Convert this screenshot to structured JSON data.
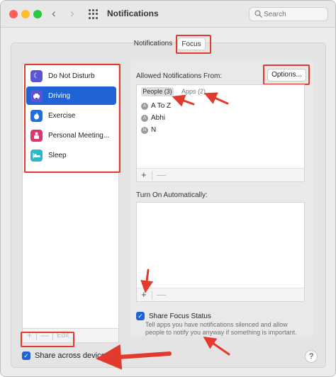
{
  "window": {
    "title": "Notifications"
  },
  "search": {
    "placeholder": "Search"
  },
  "tabs": [
    {
      "label": "Notifications"
    },
    {
      "label": "Focus"
    }
  ],
  "focus_modes": [
    {
      "label": "Do Not Disturb",
      "icon": "moon-icon",
      "color": "#5b55d6",
      "selected": false
    },
    {
      "label": "Driving",
      "icon": "car-icon",
      "color": "#5b55d6",
      "selected": true
    },
    {
      "label": "Exercise",
      "icon": "flame-icon",
      "color": "#1f6fe0",
      "selected": false
    },
    {
      "label": "Personal Meeting...",
      "icon": "person-icon",
      "color": "#e0356b",
      "selected": false
    },
    {
      "label": "Sleep",
      "icon": "bed-icon",
      "color": "#2fb6c9",
      "selected": false
    }
  ],
  "list_controls": {
    "add": "+",
    "remove": "—",
    "edit": "Edit"
  },
  "share_across_devices": {
    "label": "Share across devices",
    "checked": true
  },
  "allowed": {
    "label": "Allowed Notifications From:",
    "options_button": "Options...",
    "segments": {
      "people": "People (3)",
      "apps": "Apps (2)"
    },
    "people": [
      {
        "initial": "A",
        "name": "A To Z"
      },
      {
        "initial": "A",
        "name": "Abhi"
      },
      {
        "initial": "N",
        "name": "N"
      }
    ]
  },
  "turn_on": {
    "label": "Turn On Automatically:"
  },
  "share_focus_status": {
    "label": "Share Focus Status",
    "checked": true,
    "description": "Tell apps you have notifications silenced and allow people to notify you anyway if something is important."
  },
  "help": {
    "label": "?"
  },
  "colors": {
    "accent": "#1f63d6",
    "annotation": "#e23b2e"
  }
}
